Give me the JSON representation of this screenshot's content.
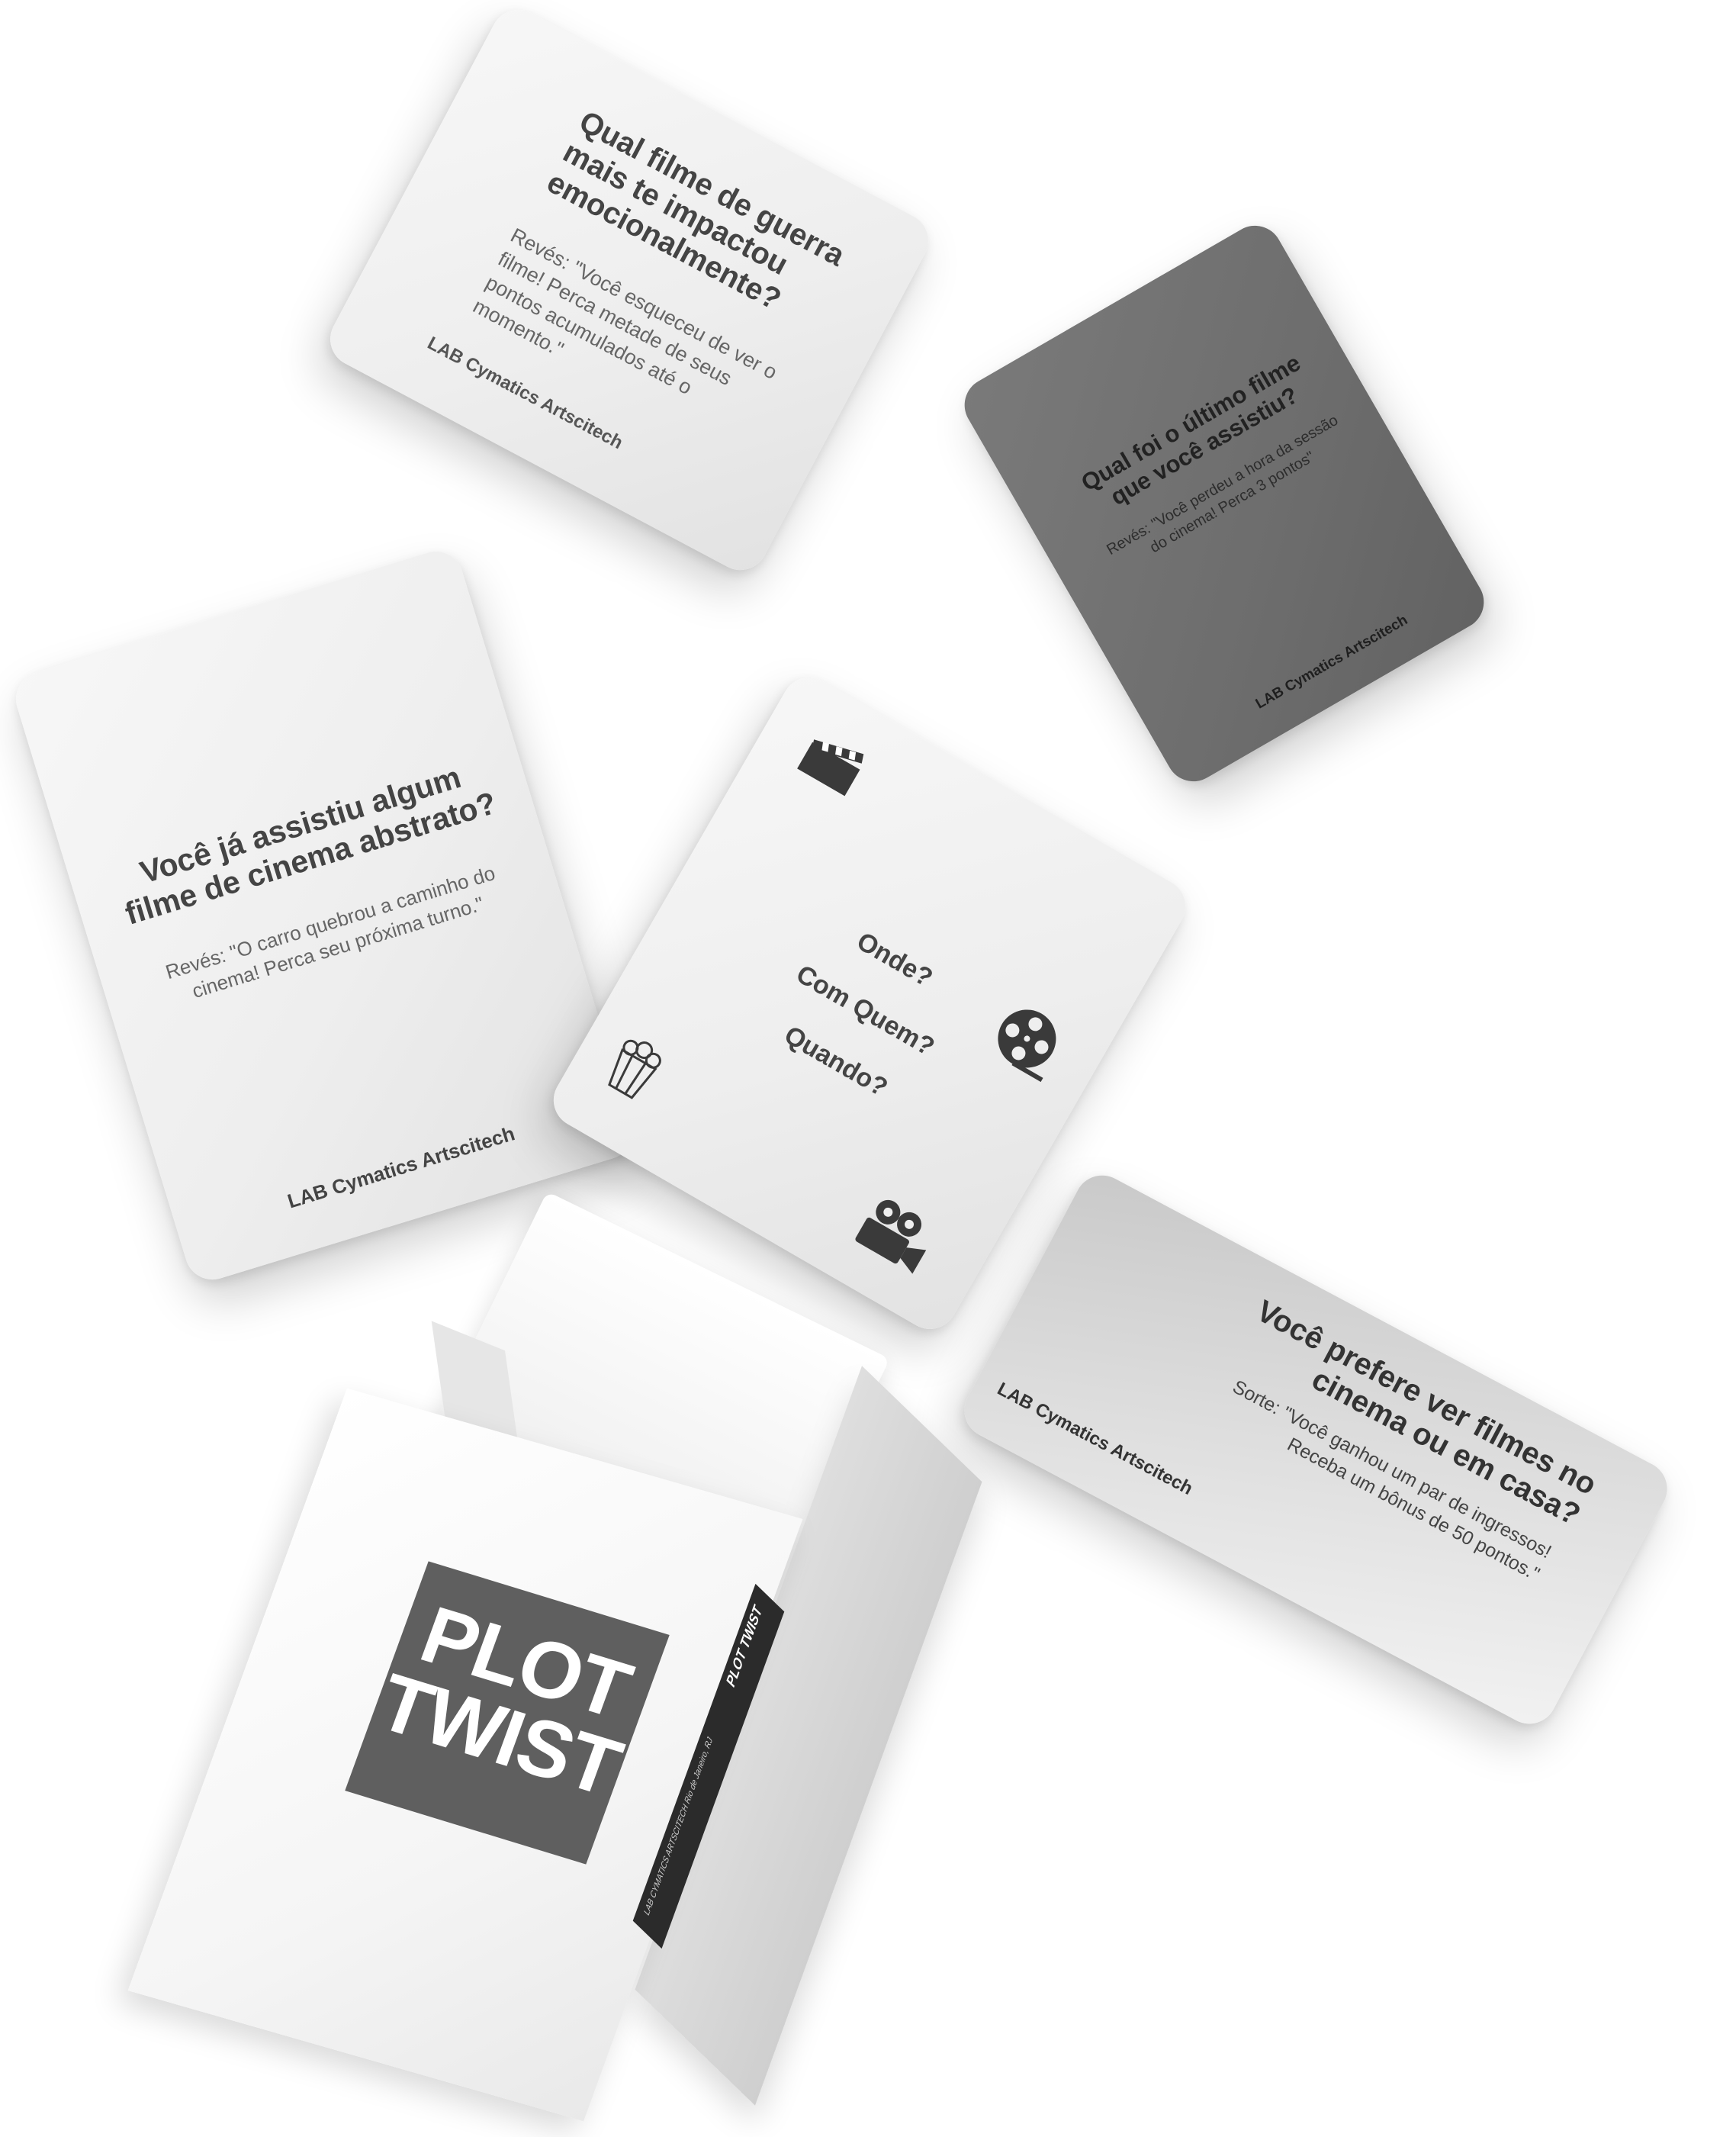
{
  "cards": {
    "card1": {
      "question": "Qual filme de guerra mais te impactou emocionalmente?",
      "reves": "Revés: \"Você esqueceu de ver o filme! Perca metade de seus pontos acumulados até o momento.\"",
      "brand": "LAB Cymatics Artscitech"
    },
    "card2": {
      "question": "Qual foi o último filme que você assistiu?",
      "reves": "Revés: \"Você perdeu a hora da sessão do cinema! Perca 3 pontos\"",
      "brand": "LAB Cymatics Artscitech"
    },
    "card3": {
      "question": "Você já assistiu algum filme de cinema abstrato?",
      "reves": "Revés: \"O carro quebrou a caminho do cinema! Perca seu próxima turno.\"",
      "brand": "LAB Cymatics Artscitech"
    },
    "card4": {
      "lines": [
        "Onde?",
        "Com Quem?",
        "Quando?"
      ],
      "icons": [
        "clapperboard-icon",
        "film-reel-icon",
        "popcorn-icon",
        "movie-camera-icon"
      ]
    },
    "card5": {
      "question": "Você prefere ver filmes no cinema ou em casa?",
      "sorte": "Sorte: \"Você ganhou um par de ingressos! Receba um bônus de 50 pontos.\"",
      "brand": "LAB Cymatics Artscitech"
    }
  },
  "box": {
    "logo_line1": "PLOT",
    "logo_line2": "TWIST",
    "spine_title": "PLOT TWIST",
    "spine_sub": "LAB CYMATICS ARTSCITECH Rio de Janeiro, RJ"
  },
  "colors": {
    "logo_plate": "#5f5f5f",
    "dark_card": "#6d6d6d",
    "spine_strip": "#2b2b2b"
  }
}
